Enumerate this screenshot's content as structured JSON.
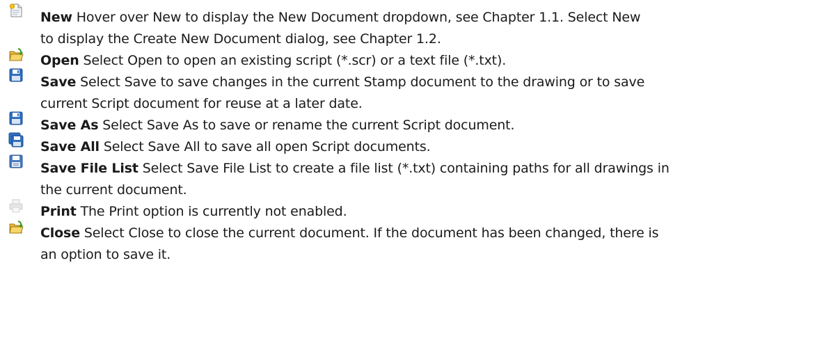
{
  "items": [
    {
      "label": "New",
      "lines": [
        "Hover over New to display the New Document dropdown, see Chapter 1.1. Select New",
        "to display the Create New Document dialog, see Chapter 1.2."
      ],
      "icon": "new-document-icon"
    },
    {
      "label": "Open",
      "lines": [
        "Select Open to open an existing script (*.scr) or a text file (*.txt)."
      ],
      "icon": "open-folder-icon"
    },
    {
      "label": "Save",
      "lines": [
        "Select Save to save changes in the current Stamp document to the drawing or to save",
        "current Script document for reuse at a later date."
      ],
      "icon": "save-icon"
    },
    {
      "label": "Save As",
      "lines": [
        "Select Save As to save or rename the current Script document."
      ],
      "icon": "save-as-icon"
    },
    {
      "label": "Save All",
      "lines": [
        "Select Save All to save all open Script documents."
      ],
      "icon": "save-all-icon"
    },
    {
      "label": "Save File List",
      "lines": [
        "Select Save File List to create a file list (*.txt) containing paths for all drawings in",
        "the current document."
      ],
      "icon": "save-file-list-icon"
    },
    {
      "label": "Print",
      "lines": [
        "The Print option is currently not enabled."
      ],
      "icon": "print-icon"
    },
    {
      "label": "Close",
      "lines": [
        "Select Close to close the current document. If the document has been changed, there is",
        "an option to save it."
      ],
      "icon": "close-folder-icon"
    }
  ]
}
